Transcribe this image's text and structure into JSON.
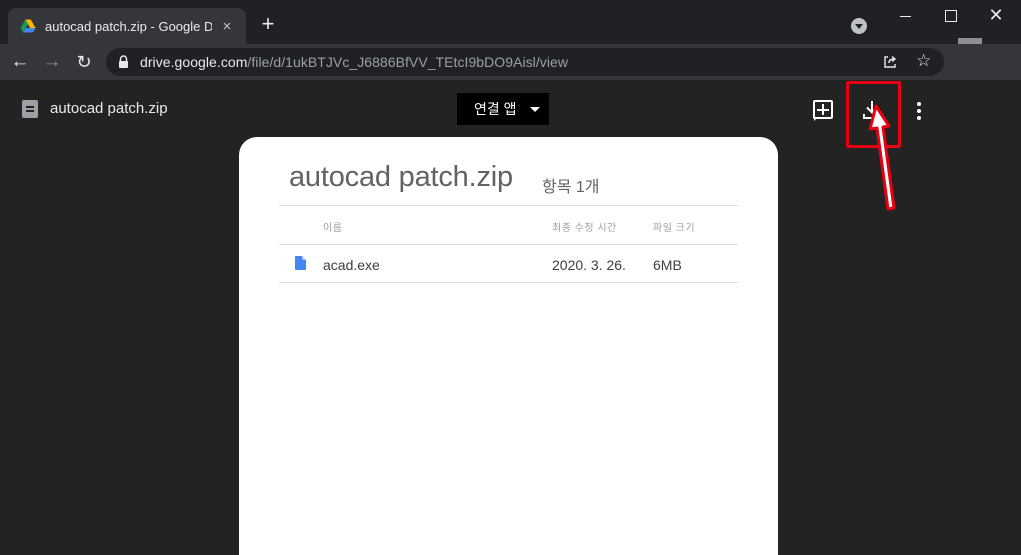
{
  "browser": {
    "tab_title": "autocad patch.zip - Google Drive",
    "tab_close": "×",
    "new_tab": "+",
    "window_close": "✕",
    "back": "←",
    "forward": "→",
    "reload": "↻",
    "star": "☆",
    "url_host": "drive.google.com",
    "url_path": "/file/d/1ukBTJVc_J6886BfVV_TEtcI9bDO9Aisl/view"
  },
  "viewer": {
    "file_name": "autocad patch.zip",
    "open_with_label": "연결 앱",
    "sheet_title": "autocad patch.zip",
    "item_count": "항목 1개",
    "columns": {
      "name": "이름",
      "modified": "최종 수정 시간",
      "size": "파일 크기"
    },
    "files": [
      {
        "name": "acad.exe",
        "modified": "2020. 3. 26.",
        "size": "6MB"
      }
    ]
  },
  "colors": {
    "highlight": "#e60012",
    "tab_bg": "#35363a",
    "viewer_bg": "#232323",
    "doc_icon": "#4285f4"
  },
  "icons": [
    "google-drive-icon",
    "lock-icon",
    "share-icon",
    "star-icon",
    "archive-file-icon",
    "add-to-drive-icon",
    "download-icon",
    "more-vert-icon",
    "document-icon"
  ]
}
